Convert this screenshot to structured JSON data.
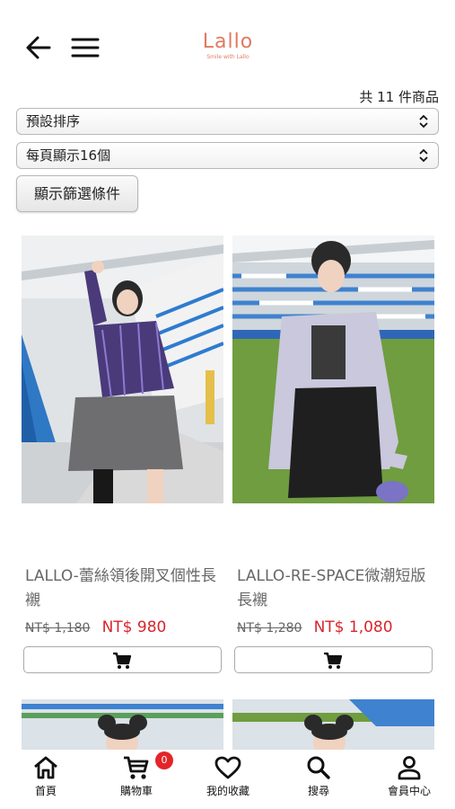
{
  "header": {
    "logo_text": "Lallo",
    "logo_tagline": "Smile with Lallo"
  },
  "result_count": "共 11 件商品",
  "sort_select": {
    "selected": "預設排序"
  },
  "per_page_select": {
    "selected": "每頁顯示16個"
  },
  "filter_button_label": "顯示篩選條件",
  "products": [
    {
      "name": "LALLO-蕾絲領後開叉個性長襯",
      "old_price": "NT$ 1,180",
      "price": "NT$ 980"
    },
    {
      "name": "LALLO-RE-SPACE微潮短版長襯",
      "old_price": "NT$ 1,280",
      "price": "NT$ 1,080"
    }
  ],
  "bottom_nav": {
    "home": "首頁",
    "cart": "購物車",
    "cart_badge": "0",
    "favorites": "我的收藏",
    "search": "搜尋",
    "member": "會員中心"
  },
  "colors": {
    "accent": "#e07a5f",
    "sale_price": "#d7262c",
    "badge": "#e3252a"
  }
}
